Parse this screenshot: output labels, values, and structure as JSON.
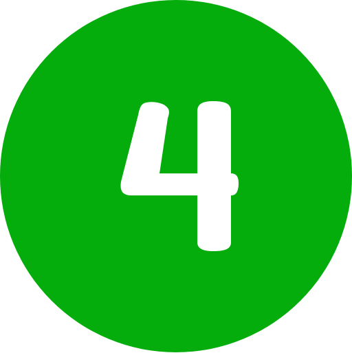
{
  "badge": {
    "number": "4",
    "icon": "number-4-circle-icon",
    "background_color": "#04ac0c",
    "foreground_color": "#ffffff"
  }
}
